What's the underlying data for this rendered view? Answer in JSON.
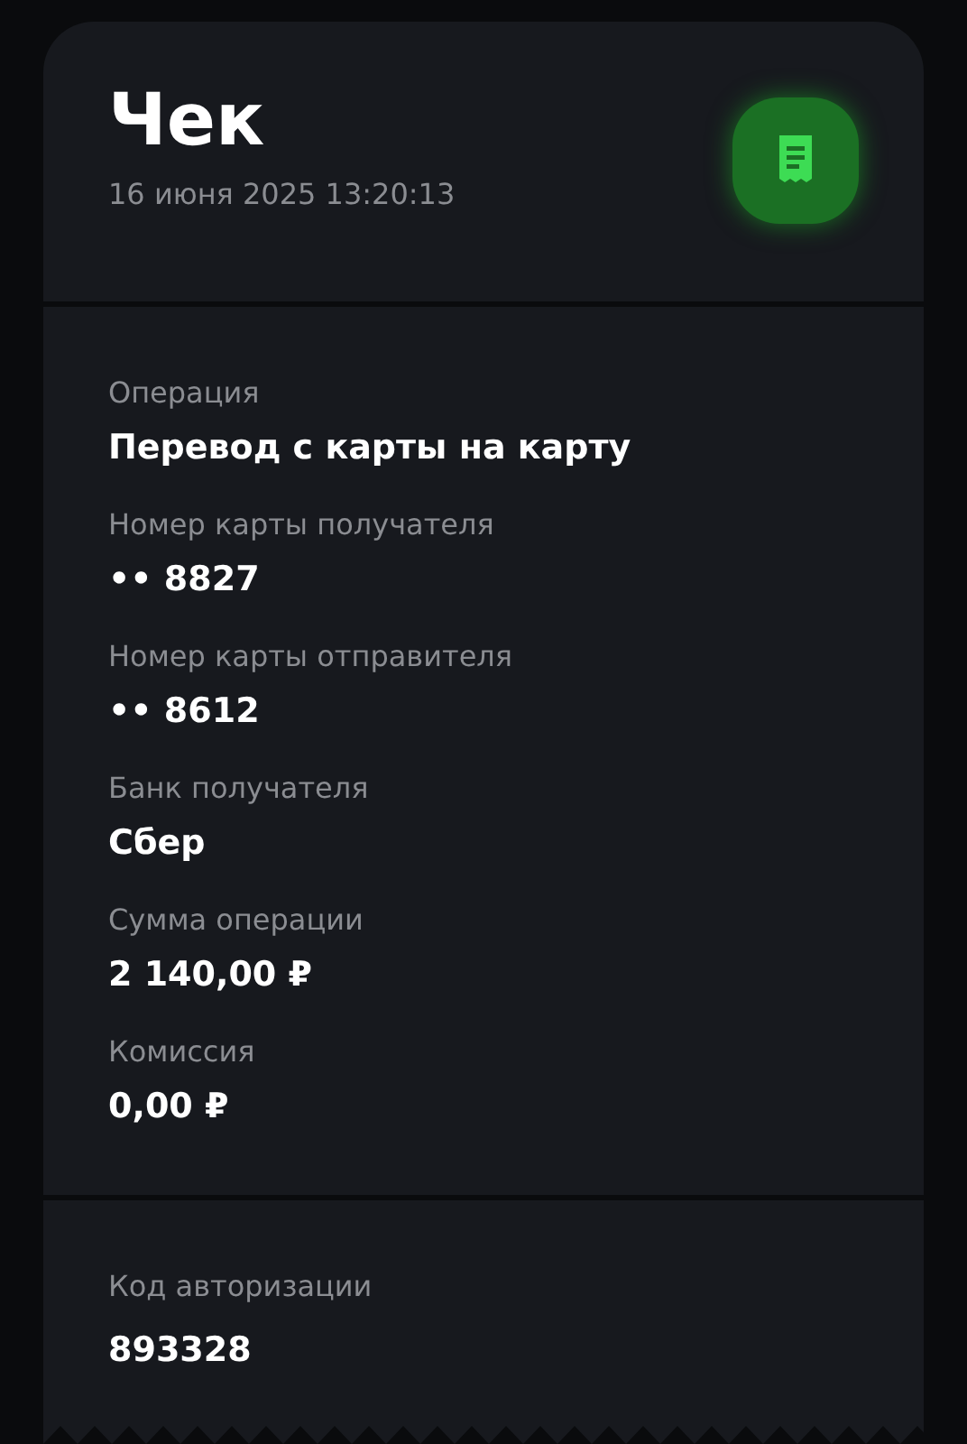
{
  "header": {
    "title": "Чек",
    "date": "16 июня 2025 13:20:13"
  },
  "details": [
    {
      "label": "Операция",
      "value": "Перевод с карты на карту"
    },
    {
      "label": "Номер карты получателя",
      "value": "•• 8827"
    },
    {
      "label": "Номер карты отправителя",
      "value": "•• 8612"
    },
    {
      "label": "Банк получателя",
      "value": "Сбер"
    },
    {
      "label": "Сумма операции",
      "value": "2 140,00 ₽"
    },
    {
      "label": "Комиссия",
      "value": "0,00 ₽"
    }
  ],
  "auth": {
    "label": "Код авторизации",
    "value": "893328"
  }
}
